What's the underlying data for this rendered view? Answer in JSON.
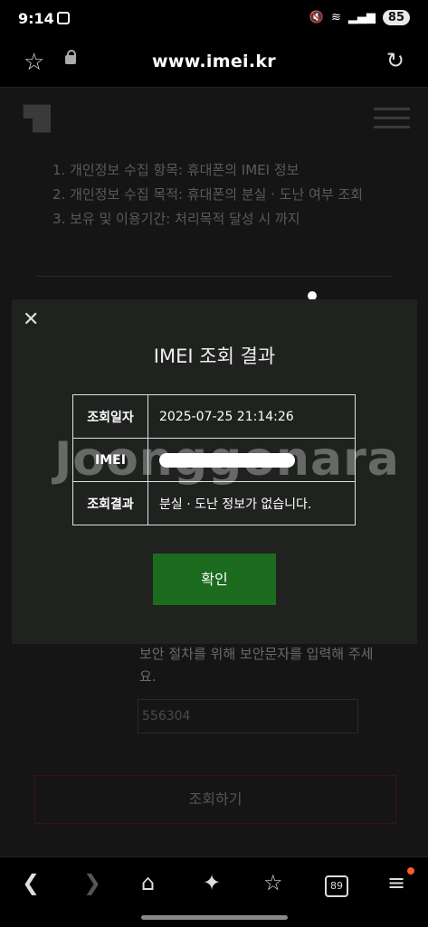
{
  "status": {
    "time": "9:14",
    "battery": "85"
  },
  "browser": {
    "url": "www.imei.kr"
  },
  "background_page": {
    "notice": [
      "1. 개인정보 수집 항목: 휴대폰의 IMEI 정보",
      "2. 개인정보 수집 목적: 휴대폰의 분실 · 도난 여부 조회",
      "3. 보유 및 이용기간: 처리목적 달성 시 까지"
    ],
    "captcha_instruction": "보안 절차를 위해 보안문자를 입력해 주세요.",
    "captcha_value": "556304",
    "submit_label": "조회하기"
  },
  "modal": {
    "title": "IMEI 조회 결과",
    "rows": [
      {
        "label": "조회일자",
        "value": "2025-07-25 21:14:26"
      },
      {
        "label": "IMEI",
        "value": ""
      },
      {
        "label": "조회결과",
        "value": "분실 · 도난 정보가 없습니다."
      }
    ],
    "confirm_label": "확인"
  },
  "watermark": "Joonggonara",
  "bottom_nav": {
    "tab_count": "89"
  }
}
